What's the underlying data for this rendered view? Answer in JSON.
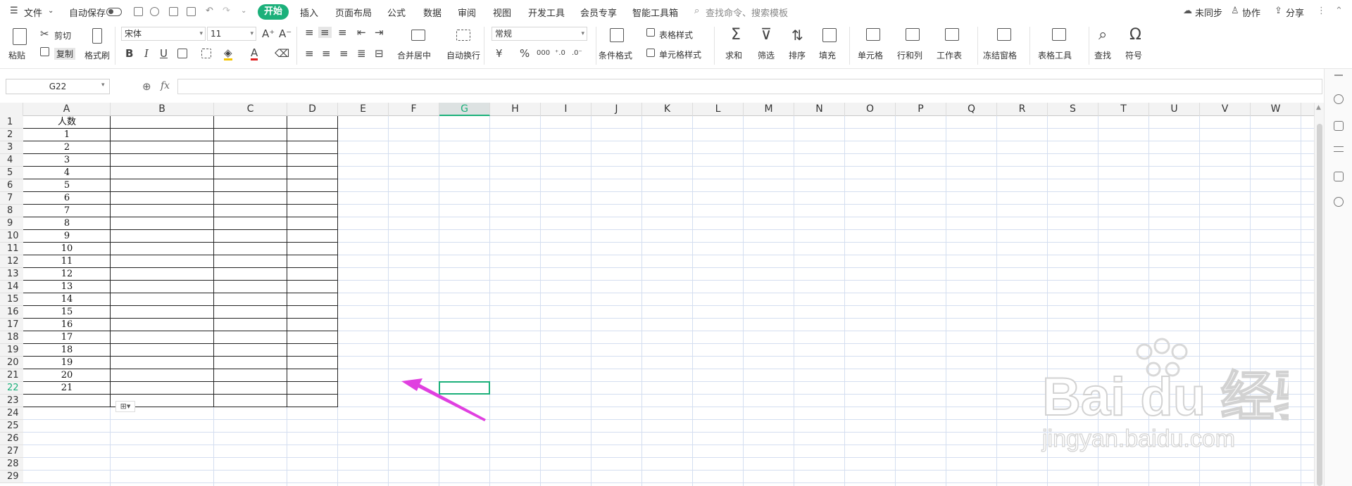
{
  "menubar": {
    "file": "文件",
    "autosave": "自动保存",
    "tabs": [
      "开始",
      "插入",
      "页面布局",
      "公式",
      "数据",
      "审阅",
      "视图",
      "开发工具",
      "会员专享",
      "智能工具箱"
    ],
    "search_placeholder": "查找命令、搜索模板",
    "sync": "未同步",
    "collab": "协作",
    "share": "分享"
  },
  "ribbon": {
    "paste": "粘贴",
    "cut": "剪切",
    "copy": "复制",
    "format_painter": "格式刷",
    "font_name": "宋体",
    "font_size": "11",
    "merge_center": "合并居中",
    "wrap": "自动换行",
    "number_format": "常规",
    "cond_format": "条件格式",
    "table_style": "表格样式",
    "cell_style": "单元格样式",
    "sum": "求和",
    "filter": "筛选",
    "sort": "排序",
    "fill": "填充",
    "cell": "单元格",
    "rowcol": "行和列",
    "sheet": "工作表",
    "freeze": "冻结窗格",
    "table_tools": "表格工具",
    "find": "查找",
    "symbol": "符号"
  },
  "formula": {
    "namebox": "G22",
    "fx": "fx"
  },
  "sheet": {
    "columns": [
      "A",
      "B",
      "C",
      "D",
      "E",
      "F",
      "G",
      "H",
      "I",
      "J",
      "K",
      "L",
      "M",
      "N",
      "O",
      "P",
      "Q",
      "R",
      "S",
      "T",
      "U",
      "V",
      "W"
    ],
    "selected_column": "G",
    "rows": [
      "1",
      "2",
      "3",
      "4",
      "5",
      "6",
      "7",
      "8",
      "9",
      "10",
      "11",
      "12",
      "13",
      "14",
      "15",
      "16",
      "17",
      "18",
      "19",
      "20",
      "21",
      "22",
      "23",
      "24",
      "25",
      "26",
      "27",
      "28",
      "29"
    ],
    "selected_row": "22",
    "column_a": [
      "人数",
      "1",
      "2",
      "3",
      "4",
      "5",
      "6",
      "7",
      "8",
      "9",
      "10",
      "11",
      "12",
      "13",
      "14",
      "15",
      "16",
      "17",
      "18",
      "19",
      "20",
      "21"
    ]
  },
  "watermark": {
    "brand": "Bai du 经验",
    "url": "jingyan.baidu.com"
  },
  "colors": {
    "accent": "#1bb07a",
    "arrow": "#e040e0"
  }
}
